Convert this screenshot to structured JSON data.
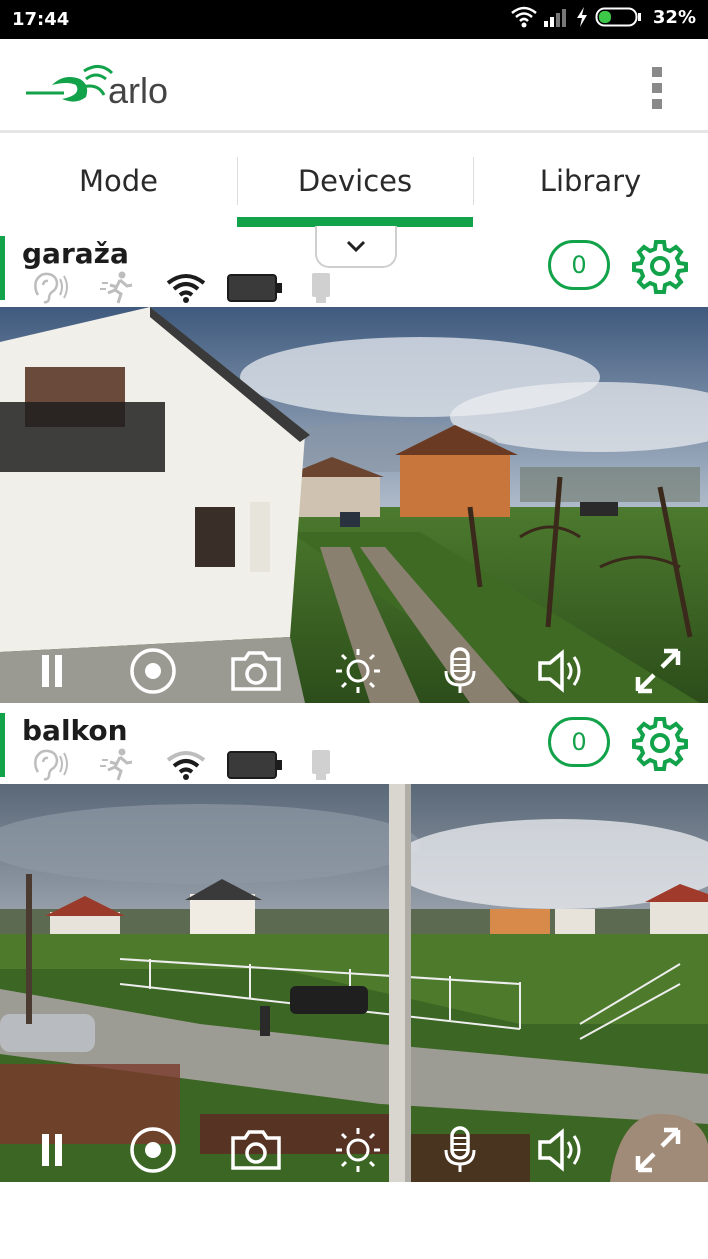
{
  "status_bar": {
    "time": "17:44",
    "battery_percent": "32%"
  },
  "app": {
    "brand": "arlo"
  },
  "tabs": [
    {
      "label": "Mode",
      "selected": false
    },
    {
      "label": "Devices",
      "selected": true
    },
    {
      "label": "Library",
      "selected": false
    }
  ],
  "devices": [
    {
      "name": "garaža",
      "count": "0"
    },
    {
      "name": "balkon",
      "count": "0"
    }
  ],
  "controls": [
    "pause",
    "record",
    "snapshot",
    "brightness",
    "microphone",
    "speaker",
    "fullscreen"
  ],
  "colors": {
    "accent": "#12a24a",
    "status_bar": "#000000"
  }
}
